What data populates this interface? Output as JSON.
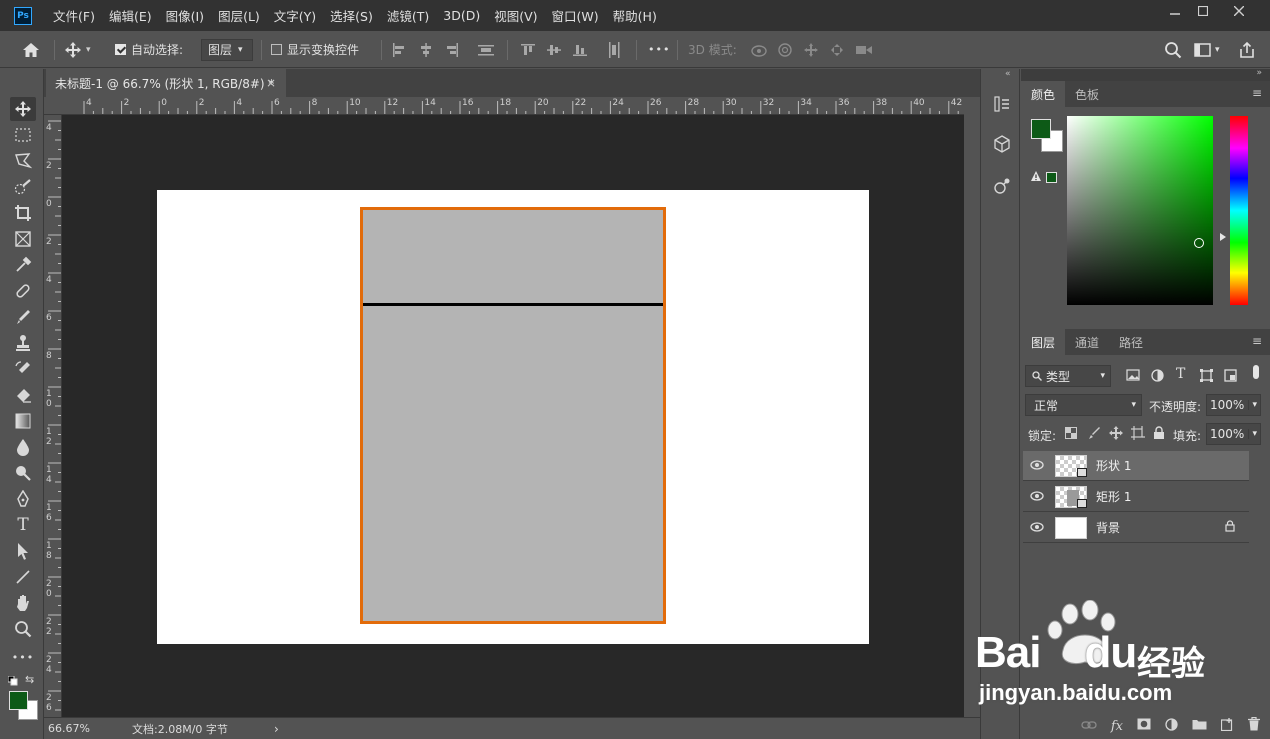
{
  "app": {
    "logo": "Ps"
  },
  "menu": [
    "文件(F)",
    "编辑(E)",
    "图像(I)",
    "图层(L)",
    "文字(Y)",
    "选择(S)",
    "滤镜(T)",
    "3D(D)",
    "视图(V)",
    "窗口(W)",
    "帮助(H)"
  ],
  "options": {
    "auto_select_label": "自动选择:",
    "auto_select_checked": true,
    "auto_select_target": "图层",
    "show_transform_label": "显示变换控件",
    "mode_3d_label": "3D 模式:",
    "more": "•••"
  },
  "document_tab": {
    "title": "未标题-1 @ 66.7% (形状 1, RGB/8#) *",
    "close": "×"
  },
  "ruler_h_labels": [
    "4",
    "2",
    "0",
    "2",
    "4",
    "6",
    "8",
    "10",
    "12",
    "14",
    "16",
    "18",
    "20",
    "22",
    "24",
    "26",
    "28",
    "30",
    "32",
    "34",
    "36",
    "38",
    "40",
    "42"
  ],
  "ruler_v_labels": [
    "4",
    "2",
    "0",
    "2",
    "4",
    "6",
    "8",
    "1 0",
    "1 2",
    "1 4",
    "1 6",
    "1 8",
    "2 0",
    "2 2",
    "2 4",
    "2 6"
  ],
  "status": {
    "zoom": "66.67%",
    "doc_info": "文档:2.08M/0 字节",
    "arrow": "›"
  },
  "color_panel": {
    "tabs": [
      "颜色",
      "色板"
    ],
    "foreground": "#0d5a17",
    "background": "#ffffff",
    "hue_base": "#00ff00"
  },
  "layers_panel": {
    "tabs": [
      "图层",
      "通道",
      "路径"
    ],
    "filter_kind": "类型",
    "blend_mode": "正常",
    "opacity_label": "不透明度:",
    "opacity_value": "100%",
    "lock_label": "锁定:",
    "fill_label": "填充:",
    "fill_value": "100%",
    "layers": [
      {
        "name": "形状 1",
        "selected": true
      },
      {
        "name": "矩形 1",
        "selected": false
      },
      {
        "name": "背景",
        "selected": false,
        "locked": true
      }
    ]
  },
  "watermark": {
    "brand": "Bai",
    "brand2": "du",
    "product": "经验",
    "url": "jingyan.baidu.com"
  }
}
